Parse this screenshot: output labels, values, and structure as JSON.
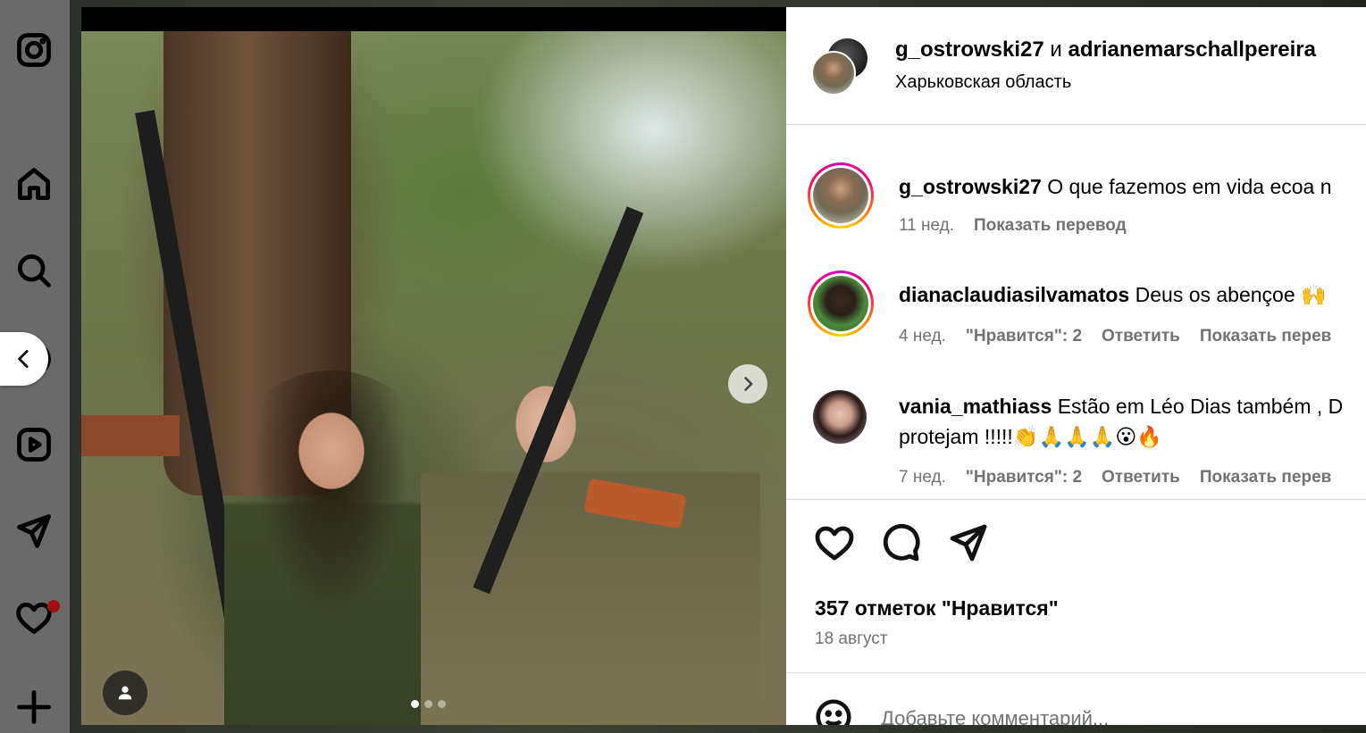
{
  "nav": {
    "items": [
      {
        "name": "instagram-logo-icon"
      },
      {
        "name": "home-icon"
      },
      {
        "name": "search-icon"
      },
      {
        "name": "explore-icon"
      },
      {
        "name": "reels-icon"
      },
      {
        "name": "messages-icon"
      },
      {
        "name": "notifications-icon"
      },
      {
        "name": "create-icon"
      }
    ],
    "notification_dot_color": "#a01010"
  },
  "post": {
    "header": {
      "author": "g_ostrowski27",
      "conjunction": "и",
      "coauthor": "adrianemarschallpereira",
      "location": "Харьковская область"
    },
    "carousel": {
      "slide_count": 3,
      "active_index": 0
    },
    "caption": {
      "username": "g_ostrowski27",
      "text": "O que fazemos em vida ecoa n",
      "age": "11 нед.",
      "translate": "Показать перевод"
    },
    "comments": [
      {
        "username": "dianaclaudiasilvamatos",
        "text": "Deus os abençoe 🙌",
        "age": "4 нед.",
        "likes": "\"Нравится\": 2",
        "reply": "Ответить",
        "translate": "Показать перев"
      },
      {
        "username": "vania_mathiass",
        "text": "Estão em Léo Dias também , D",
        "text_line2": "protejam !!!!!👏🙏🙏🙏😮🔥",
        "age": "7 нед.",
        "likes": "\"Нравится\": 2",
        "reply": "Ответить",
        "translate": "Показать перев"
      }
    ],
    "likes_count": "357 отметок \"Нравится\"",
    "date": "18 август",
    "comment_placeholder": "Добавьте комментарий..."
  },
  "colors": {
    "story_ring": [
      "#d300c5",
      "#ff0069",
      "#ff7a00",
      "#ffd600"
    ],
    "muted_text": "#737373",
    "divider": "#dbdbdb"
  }
}
